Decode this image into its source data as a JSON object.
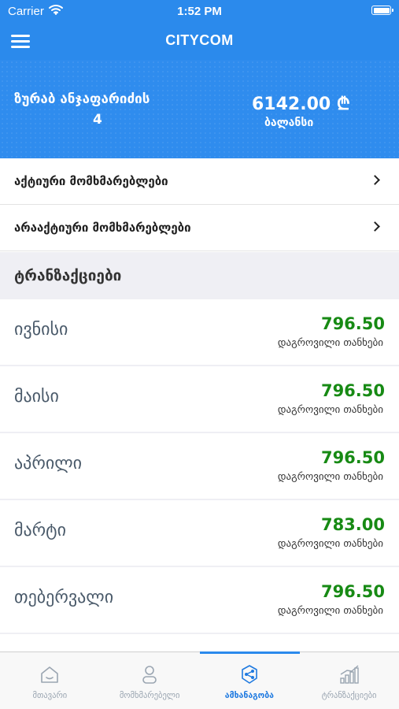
{
  "status_bar": {
    "carrier": "Carrier",
    "time": "1:52 PM"
  },
  "nav": {
    "title": "CITYCOM",
    "menu_icon": "hamburger-menu-icon"
  },
  "account": {
    "name": "ზურაბ ანჯაფარიძის",
    "number": "4",
    "balance": "6142.00 ₾",
    "balance_label": "ბალანსი"
  },
  "menu_items": [
    {
      "label": "აქტიური მომხმარებლები"
    },
    {
      "label": "არააქტიური მომხმარებლები"
    }
  ],
  "transactions_section": {
    "title": "ტრანზაქციები"
  },
  "transactions": [
    {
      "month": "ივნისი",
      "amount": "796.50",
      "note": "დაგროვილი თანხები"
    },
    {
      "month": "მაისი",
      "amount": "796.50",
      "note": "დაგროვილი თანხები"
    },
    {
      "month": "აპრილი",
      "amount": "796.50",
      "note": "დაგროვილი თანხები"
    },
    {
      "month": "მარტი",
      "amount": "783.00",
      "note": "დაგროვილი თანხები"
    },
    {
      "month": "თებერვალი",
      "amount": "796.50",
      "note": "დაგროვილი თანხები"
    }
  ],
  "colors": {
    "primary": "#2b8aec",
    "amount_green": "#178a14",
    "tab_inactive": "#9aa5b1",
    "tab_active": "#1f7ae0"
  },
  "tabs": [
    {
      "label": "მთავარი",
      "icon": "home-icon",
      "active": false
    },
    {
      "label": "მომხმარებელი",
      "icon": "user-icon",
      "active": false
    },
    {
      "label": "ამხანაგობა",
      "icon": "share-icon",
      "active": true
    },
    {
      "label": "ტრანზაქციები",
      "icon": "bar-chart-icon",
      "active": false
    }
  ]
}
